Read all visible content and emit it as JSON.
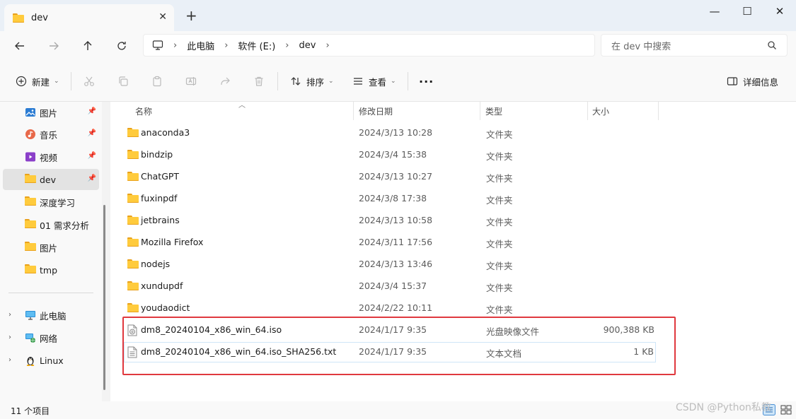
{
  "window": {
    "tab_title": "dev",
    "new_tab": "+",
    "close_tab": "✕",
    "minimize": "—",
    "maximize": "☐",
    "close": "✕"
  },
  "address": {
    "crumbs": [
      "此电脑",
      "软件 (E:)",
      "dev"
    ],
    "search_placeholder": "在 dev 中搜索"
  },
  "toolbar": {
    "new_label": "新建",
    "sort_label": "排序",
    "view_label": "查看",
    "more_label": "···",
    "details_label": "详细信息"
  },
  "sidebar": {
    "quick": [
      {
        "label": "图片",
        "icon": "pictures-icon",
        "pinned": true
      },
      {
        "label": "音乐",
        "icon": "music-icon",
        "pinned": true
      },
      {
        "label": "视频",
        "icon": "videos-icon",
        "pinned": true
      },
      {
        "label": "dev",
        "icon": "folder-icon",
        "pinned": true,
        "selected": true
      },
      {
        "label": "深度学习",
        "icon": "folder-icon"
      },
      {
        "label": "01 需求分析",
        "icon": "folder-icon"
      },
      {
        "label": "图片",
        "icon": "folder-icon"
      },
      {
        "label": "tmp",
        "icon": "folder-icon"
      }
    ],
    "roots": [
      {
        "label": "此电脑",
        "icon": "this-pc-icon"
      },
      {
        "label": "网络",
        "icon": "network-icon"
      },
      {
        "label": "Linux",
        "icon": "linux-icon"
      }
    ]
  },
  "columns": {
    "name": "名称",
    "date": "修改日期",
    "type": "类型",
    "size": "大小"
  },
  "files": [
    {
      "name": "anaconda3",
      "date": "2024/3/13 10:28",
      "type": "文件夹",
      "size": "",
      "icon": "folder-icon"
    },
    {
      "name": "bindzip",
      "date": "2024/3/4 15:38",
      "type": "文件夹",
      "size": "",
      "icon": "folder-icon"
    },
    {
      "name": "ChatGPT",
      "date": "2024/3/13 10:27",
      "type": "文件夹",
      "size": "",
      "icon": "folder-icon"
    },
    {
      "name": "fuxinpdf",
      "date": "2024/3/8 17:38",
      "type": "文件夹",
      "size": "",
      "icon": "folder-icon"
    },
    {
      "name": "jetbrains",
      "date": "2024/3/13 10:58",
      "type": "文件夹",
      "size": "",
      "icon": "folder-icon"
    },
    {
      "name": "Mozilla Firefox",
      "date": "2024/3/11 17:56",
      "type": "文件夹",
      "size": "",
      "icon": "folder-icon"
    },
    {
      "name": "nodejs",
      "date": "2024/3/13 13:46",
      "type": "文件夹",
      "size": "",
      "icon": "folder-icon"
    },
    {
      "name": "xundupdf",
      "date": "2024/3/4 15:37",
      "type": "文件夹",
      "size": "",
      "icon": "folder-icon"
    },
    {
      "name": "youdaodict",
      "date": "2024/2/22 10:11",
      "type": "文件夹",
      "size": "",
      "icon": "folder-icon"
    },
    {
      "name": "dm8_20240104_x86_win_64.iso",
      "date": "2024/1/17 9:35",
      "type": "光盘映像文件",
      "size": "900,388 KB",
      "icon": "disc-image-icon"
    },
    {
      "name": "dm8_20240104_x86_win_64.iso_SHA256.txt",
      "date": "2024/1/17 9:35",
      "type": "文本文档",
      "size": "1 KB",
      "icon": "text-file-icon",
      "selected": true
    }
  ],
  "status": {
    "item_count": "11 个项目"
  },
  "watermark": "CSDN @Python私教",
  "colors": {
    "highlight_box": "#e0383e",
    "folder": "#ffcb3d",
    "selection": "#cfe6f8"
  }
}
